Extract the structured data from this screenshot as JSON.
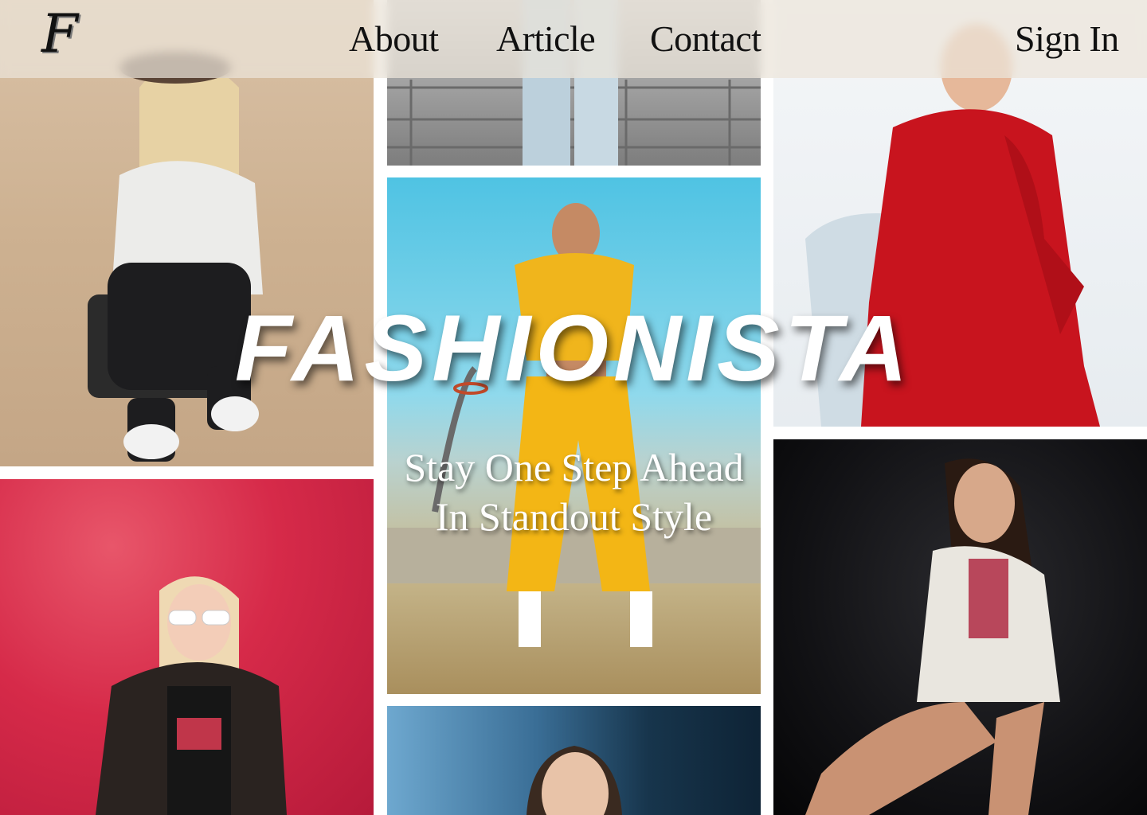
{
  "nav": {
    "logo": "F",
    "links": [
      {
        "label": "About"
      },
      {
        "label": "Article"
      },
      {
        "label": "Contact"
      }
    ],
    "sign_in": "Sign In"
  },
  "hero": {
    "title": "FASHIONISTA",
    "subtitle_line1": "Stay One Step Ahead",
    "subtitle_line2": "In Standout Style"
  },
  "colors": {
    "nav_bg": "#ebe4da",
    "text_dark": "#111111",
    "hero_text": "#ffffff"
  }
}
